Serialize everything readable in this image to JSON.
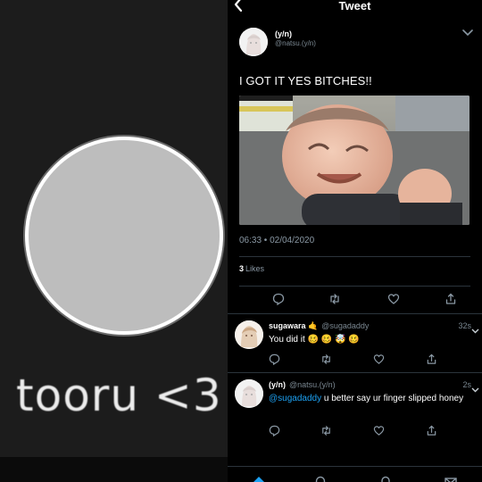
{
  "left_panel": {
    "caption": "tooru <3",
    "avatar_icon": "default-avatar-circle"
  },
  "header": {
    "back_icon": "chevron-left-icon",
    "title": "Tweet"
  },
  "tweet": {
    "display_name": "(y/n)",
    "handle": "@natsu.(y/n)",
    "text": "I GOT IT YES BITCHES!!",
    "photo_alt": "toddler smiling photo",
    "timestamp": "06:33 • 02/04/2020",
    "likes_count": "3",
    "likes_label": "Likes",
    "actions": [
      "reply-icon",
      "retweet-icon",
      "like-icon",
      "share-icon"
    ]
  },
  "replies": [
    {
      "display_name": "sugawara 🤙",
      "handle": "@sugadaddy",
      "time": "32s",
      "text": "You did it 🥴 🥴 🤯 🥴"
    },
    {
      "display_name": "(y/n)",
      "handle": "@natsu.(y/n)",
      "time": "2s",
      "mention": "@sugadaddy",
      "text": " u better say ur finger slipped honey"
    }
  ],
  "tabbar": [
    "home-icon",
    "search-icon",
    "notifications-icon",
    "messages-icon"
  ],
  "colors": {
    "accent": "#1da1f2",
    "secondary_text": "#8a98a4",
    "divider": "#2b343c"
  }
}
